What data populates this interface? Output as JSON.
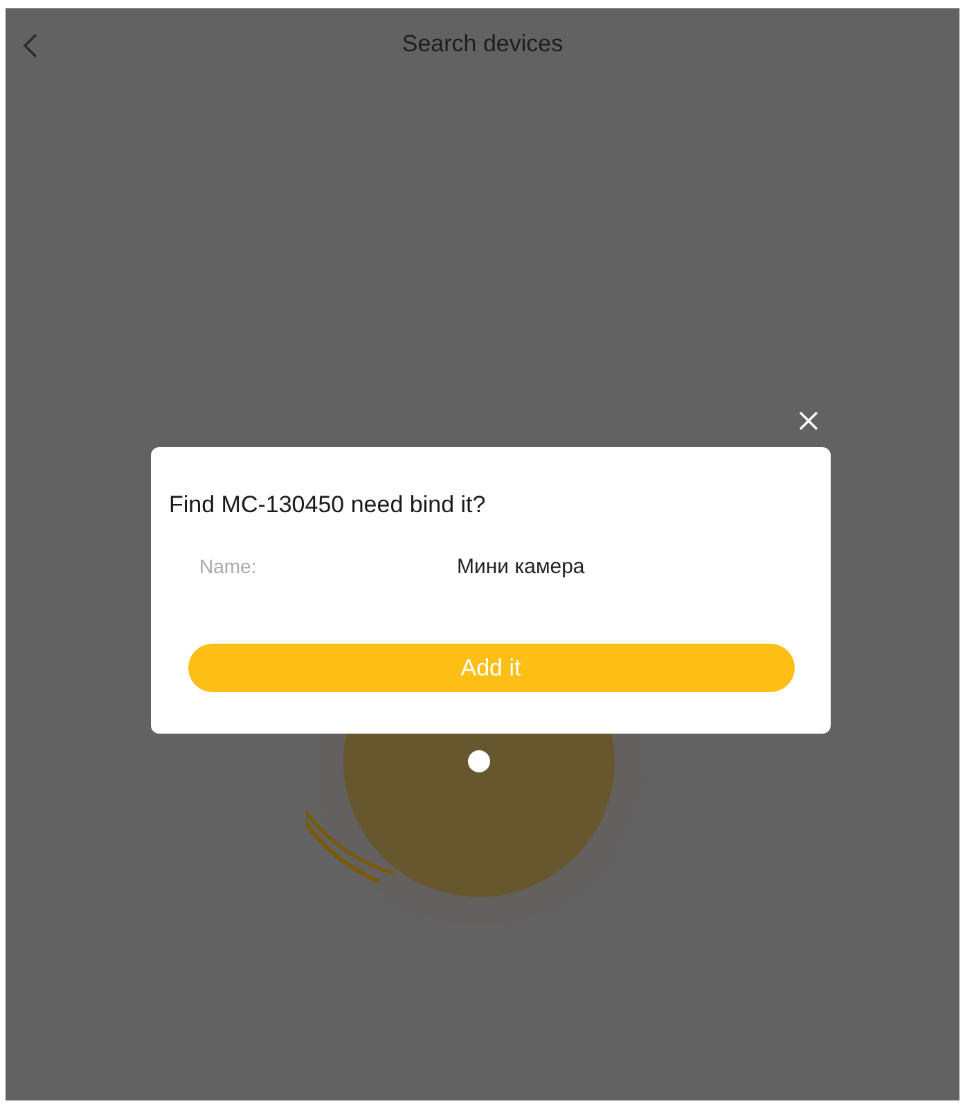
{
  "header": {
    "title": "Search devices"
  },
  "dialog": {
    "title": "Find MC-130450 need bind it?",
    "field": {
      "label": "Name:",
      "value": "Мини камера"
    },
    "button": "Add it"
  }
}
